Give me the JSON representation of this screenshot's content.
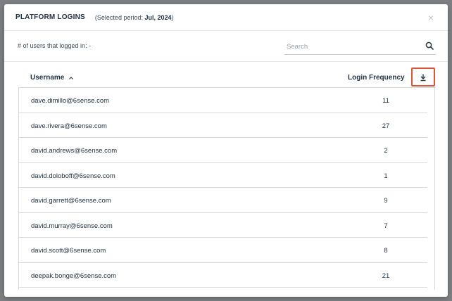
{
  "modal": {
    "title": "PLATFORM LOGINS",
    "period_prefix": "(Selected period: ",
    "period_value": "Jul, 2024",
    "period_suffix": ")",
    "close_glyph": "×"
  },
  "toolbar": {
    "users_count_label": "# of users that logged in: -",
    "search_placeholder": "Search"
  },
  "table": {
    "columns": {
      "username": "Username",
      "login_frequency": "Login Frequency"
    },
    "rows": [
      {
        "username": "dave.dimillo@6sense.com",
        "frequency": "11"
      },
      {
        "username": "dave.rivera@6sense.com",
        "frequency": "27"
      },
      {
        "username": "david.andrews@6sense.com",
        "frequency": "2"
      },
      {
        "username": "david.doloboff@6sense.com",
        "frequency": "1"
      },
      {
        "username": "david.garrett@6sense.com",
        "frequency": "9"
      },
      {
        "username": "david.murray@6sense.com",
        "frequency": "7"
      },
      {
        "username": "david.scott@6sense.com",
        "frequency": "8"
      },
      {
        "username": "deepak.bonge@6sense.com",
        "frequency": "21"
      }
    ]
  },
  "icons": {
    "close": "close-icon",
    "search": "search-icon",
    "sort": "sort-ascending-icon",
    "download": "download-icon"
  },
  "colors": {
    "highlight_border": "#e0553a",
    "text_primary": "#1f3142",
    "overlay": "#7d7f82"
  }
}
